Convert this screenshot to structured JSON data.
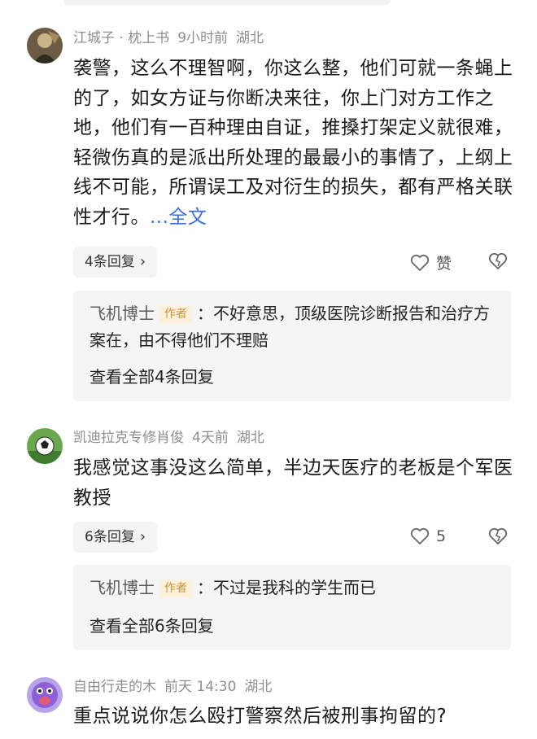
{
  "comments": [
    {
      "username": "江城子 · 枕上书",
      "time": "9小时前",
      "location": "湖北",
      "text": "袭警，这么不理智啊，你这么整，他们可就一条蝇上的了，如女方证与你断决来往，你上门对方工作之地，他们有一百种理由自证，推搡打架定义就很难，轻微伤真的是派出所处理的最最小的事情了，上纲上线不可能，所谓误工及对衍生的损失，都有严格关联性才行。",
      "more": "...全文",
      "replies_label": "4条回复",
      "like_label": "赞",
      "sub_reply": {
        "author": "飞机博士",
        "tag": "作者",
        "text": "：不好意思，顶级医院诊断报告和治疗方案在，由不得他们不理赔",
        "view_all": "查看全部4条回复"
      }
    },
    {
      "username": "凯迪拉克专修肖俊",
      "time": "4天前",
      "location": "湖北",
      "text": "我感觉这事没这么简单，半边天医疗的老板是个军医教授",
      "replies_label": "6条回复",
      "like_label": "5",
      "sub_reply": {
        "author": "飞机博士",
        "tag": "作者",
        "text": "：不过是我科的学生而已",
        "view_all": "查看全部6条回复"
      }
    },
    {
      "username": "自由行走的木",
      "time": "前天 14:30",
      "location": "湖北",
      "text": "重点说说你怎么殴打警察然后被刑事拘留的?"
    }
  ],
  "icons": {
    "like": "heart-outline-icon",
    "dislike": "broken-heart-icon",
    "chevron": "chevron-right-icon"
  },
  "colors": {
    "link": "#3b6fe0",
    "author_tag_bg": "#fdf1dc",
    "author_tag_text": "#c7953d",
    "meta": "#8e8e8e"
  }
}
